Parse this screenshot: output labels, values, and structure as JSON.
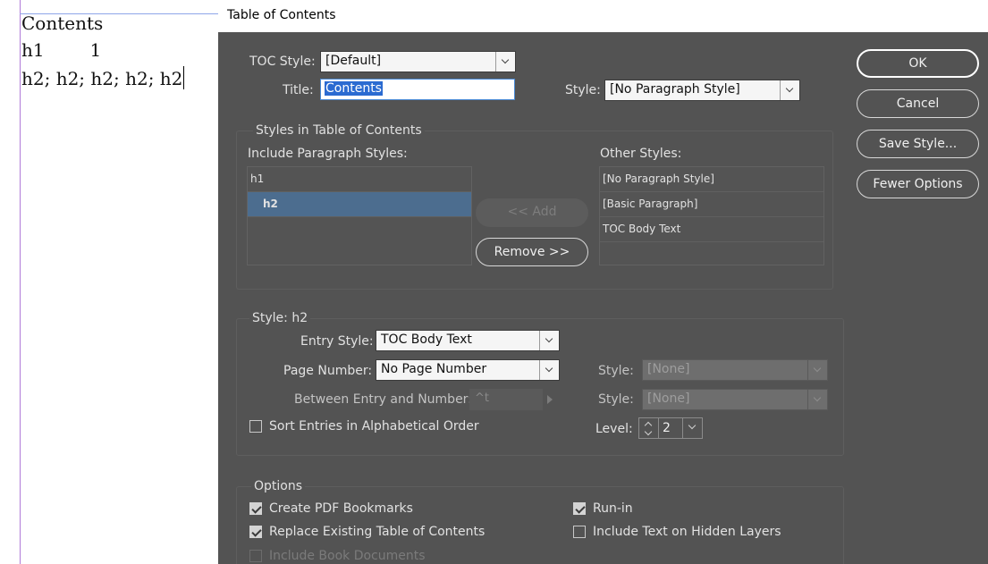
{
  "document": {
    "lines": [
      "Contents",
      "h1        1",
      "h2; h2; h2; h2; h2"
    ]
  },
  "dialog": {
    "title": "Table of Contents",
    "toc_style_label": "TOC Style:",
    "toc_style_value": "[Default]",
    "title_label": "Title:",
    "title_value": "Contents",
    "title_style_label": "Style:",
    "title_style_value": "[No Paragraph Style]",
    "styles_group": {
      "title": "Styles in Table of Contents",
      "include_label": "Include Paragraph Styles:",
      "include_items": [
        "h1",
        "h2"
      ],
      "selected_index": 1,
      "other_label": "Other Styles:",
      "other_items": [
        "[No Paragraph Style]",
        "[Basic Paragraph]",
        "TOC Body Text"
      ],
      "add_label": "<< Add",
      "remove_label": "Remove >>"
    },
    "style_group": {
      "title": "Style: h2",
      "entry_style_label": "Entry Style:",
      "entry_style_value": "TOC Body Text",
      "page_number_label": "Page Number:",
      "page_number_value": "No Page Number",
      "page_number_style_label": "Style:",
      "page_number_style_value": "[None]",
      "between_label": "Between Entry and Number:",
      "between_value": "^t",
      "between_style_label": "Style:",
      "between_style_value": "[None]",
      "sort_label": "Sort Entries in Alphabetical Order",
      "sort_checked": false,
      "level_label": "Level:",
      "level_value": "2"
    },
    "options_group": {
      "title": "Options",
      "create_pdf_bookmarks": "Create PDF Bookmarks",
      "replace_existing": "Replace Existing Table of Contents",
      "include_book_documents": "Include Book Documents",
      "run_in": "Run-in",
      "include_hidden_layers": "Include Text on Hidden Layers"
    },
    "buttons": {
      "ok": "OK",
      "cancel": "Cancel",
      "save_style": "Save Style...",
      "fewer_options": "Fewer Options"
    }
  },
  "colors": {
    "dialog_bg": "#535353",
    "selection_row": "#4c6d8f",
    "focus_border": "#4a8ad6",
    "text_selection": "#2b6bd1"
  }
}
